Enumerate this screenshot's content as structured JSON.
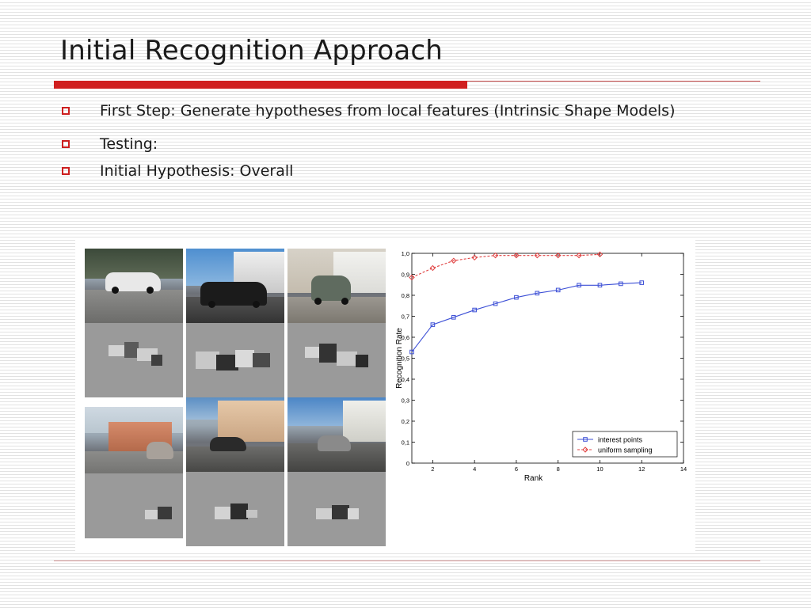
{
  "slide": {
    "title": "Initial Recognition Approach",
    "bullets": [
      "First Step: Generate hypotheses from local features (Intrinsic Shape Models)",
      "Testing:",
      "Initial Hypothesis: Overall"
    ]
  },
  "colors": {
    "accent": "#cc1f1f",
    "series_interest": "#3c4fd6",
    "series_uniform": "#e04040"
  },
  "chart_data": {
    "type": "line",
    "xlabel": "Rank",
    "ylabel": "Recognition Rate",
    "xlim": [
      1,
      14
    ],
    "ylim": [
      0,
      1.0
    ],
    "xticks": [
      2,
      4,
      6,
      8,
      10,
      12,
      14
    ],
    "yticks": [
      0,
      0.1,
      0.2,
      0.3,
      0.4,
      0.5,
      0.6,
      0.7,
      0.8,
      0.9,
      1.0
    ],
    "ytick_labels": [
      "0",
      "0,1",
      "0,2",
      "0,3",
      "0,4",
      "0,5",
      "0,6",
      "0,7",
      "0,8",
      "0,9",
      "1,0"
    ],
    "grid": false,
    "legend_position": "bottom-right",
    "series": [
      {
        "name": "interest points",
        "marker": "square",
        "linestyle": "solid",
        "x": [
          1,
          2,
          3,
          4,
          5,
          6,
          7,
          8,
          9,
          10,
          11,
          12
        ],
        "y": [
          0.53,
          0.66,
          0.695,
          0.73,
          0.76,
          0.79,
          0.81,
          0.825,
          0.848,
          0.848,
          0.855,
          0.86
        ]
      },
      {
        "name": "uniform sampling",
        "marker": "diamond",
        "linestyle": "dashed",
        "x": [
          1,
          2,
          3,
          4,
          5,
          6,
          7,
          8,
          9,
          10
        ],
        "y": [
          0.885,
          0.93,
          0.965,
          0.98,
          0.99,
          0.99,
          0.99,
          0.99,
          0.99,
          0.995
        ]
      }
    ]
  }
}
